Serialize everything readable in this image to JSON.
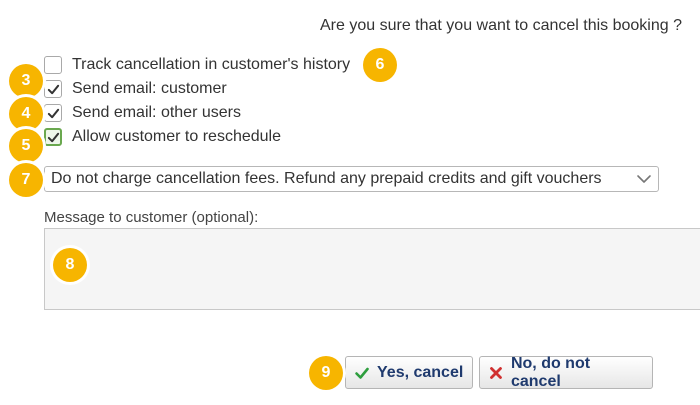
{
  "dialog": {
    "question": "Are you sure that you want to cancel this booking ?"
  },
  "options": [
    {
      "label": "Track cancellation in customer's history",
      "checked": false
    },
    {
      "label": "Send email: customer",
      "checked": true
    },
    {
      "label": "Send email: other users",
      "checked": true
    },
    {
      "label": "Allow customer to reschedule",
      "checked": true
    }
  ],
  "fees": {
    "selected": "Do not charge cancellation fees. Refund any prepaid credits and gift vouchers"
  },
  "message": {
    "label": "Message to customer (optional):",
    "value": ""
  },
  "buttons": {
    "yes_label": "Yes, cancel",
    "no_label": "No, do not cancel"
  },
  "markers": [
    "3",
    "4",
    "5",
    "6",
    "7",
    "8",
    "9"
  ],
  "colors": {
    "marker": "#f7b500",
    "button_text": "#1f3a6e",
    "check_green": "#2e9e3e",
    "cross_red": "#d03030"
  },
  "icons": {
    "check": "check-icon",
    "chevron": "chevron-down-icon",
    "yes": "check-icon",
    "no": "x-icon"
  }
}
